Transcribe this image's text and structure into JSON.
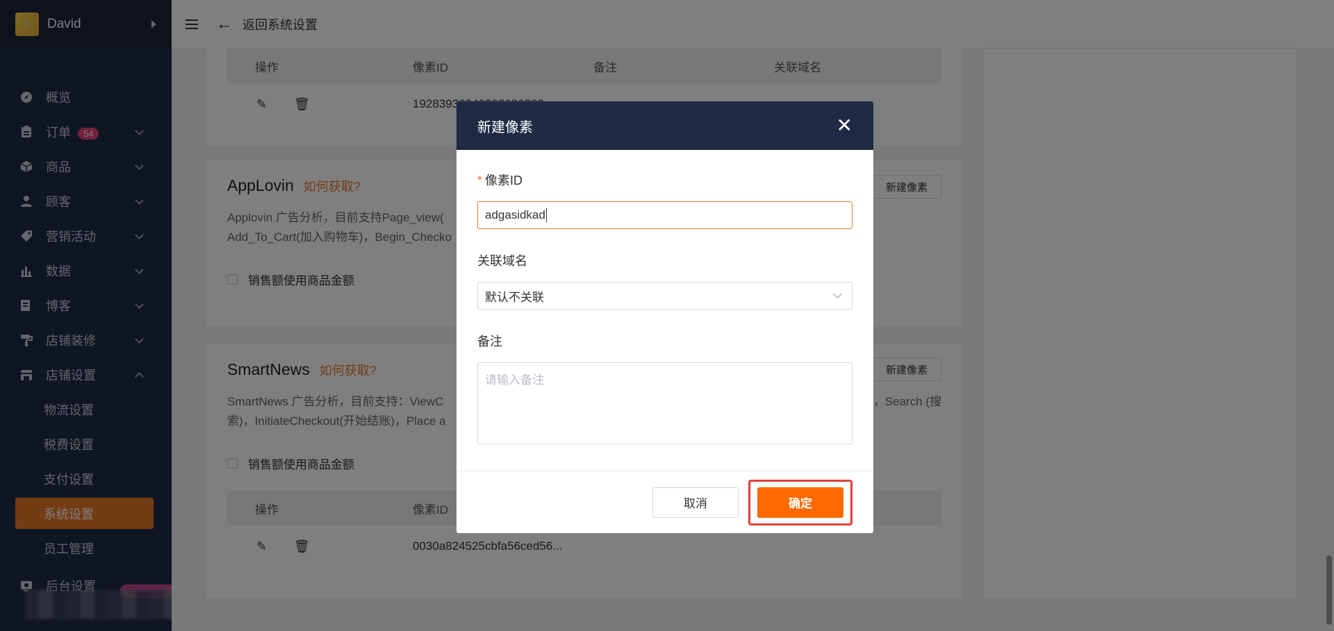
{
  "user": {
    "name": "David"
  },
  "header": {
    "back_label": "返回系统设置"
  },
  "nav": {
    "items": [
      {
        "label": "概览",
        "icon": "compass-icon"
      },
      {
        "label": "订单",
        "icon": "clipboard-icon",
        "badge": "54"
      },
      {
        "label": "商品",
        "icon": "cube-icon"
      },
      {
        "label": "顾客",
        "icon": "person-icon"
      },
      {
        "label": "营销活动",
        "icon": "tag-icon"
      },
      {
        "label": "数据",
        "icon": "bar-chart-icon"
      },
      {
        "label": "博客",
        "icon": "edit-doc-icon"
      },
      {
        "label": "店铺装修",
        "icon": "paint-roller-icon"
      },
      {
        "label": "店铺设置",
        "icon": "store-icon"
      }
    ],
    "sub_items": [
      "物流设置",
      "税费设置",
      "支付设置",
      "系统设置",
      "员工管理"
    ],
    "bottom": {
      "label": "后台设置",
      "icon": "monitor-icon"
    }
  },
  "top_card": {
    "headers": [
      "操作",
      "像素ID",
      "备注",
      "关联域名"
    ],
    "row_id": "19283936043393686383"
  },
  "applovin": {
    "title": "AppLovin",
    "link": "如何获取?",
    "desc1": "Applovin 广告分析，目前支持Page_view(",
    "desc2": "Add_To_Cart(加入购物车)，Begin_Checko",
    "checkbox": "销售额使用商品金额",
    "new_button": "新建像素"
  },
  "smartnews": {
    "title": "SmartNews",
    "link": "如何获取?",
    "desc1": "SmartNews 广告分析，目前支持：ViewC",
    "desc1_right": "，Search (搜",
    "desc2": "索)，InitiateCheckout(开始结账)，Place a",
    "checkbox": "销售额使用商品金额",
    "new_button": "新建像素",
    "headers": [
      "操作",
      "像素ID"
    ],
    "row_id": "0030a824525cbfa56ced56..."
  },
  "modal": {
    "title": "新建像素",
    "pixel_label": "像素ID",
    "pixel_value": "adgasidkad",
    "domain_label": "关联域名",
    "domain_value": "默认不关联",
    "note_label": "备注",
    "note_placeholder": "请输入备注",
    "cancel": "取消",
    "ok": "确定"
  },
  "colors": {
    "accent": "#ff6a00",
    "sidebar": "#1f2a44",
    "highlight": "#e0403a"
  }
}
